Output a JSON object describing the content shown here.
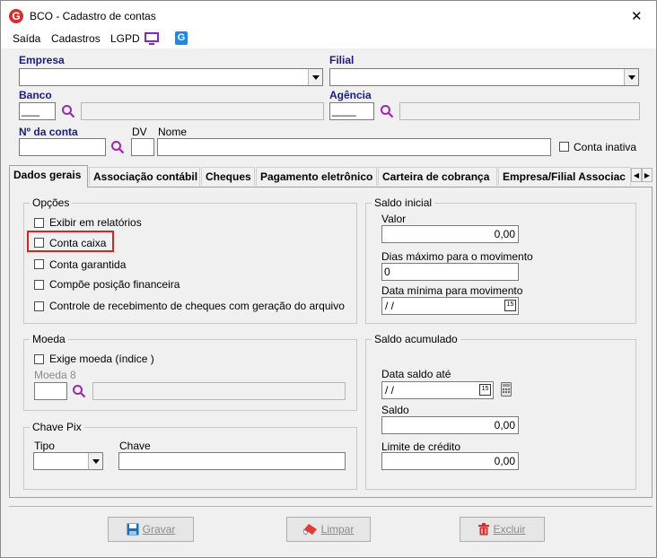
{
  "window": {
    "title": "BCO - Cadastro de contas",
    "close_glyph": "✕"
  },
  "menu": {
    "items": [
      "Saída",
      "Cadastros",
      "LGPD"
    ]
  },
  "header": {
    "empresa_label": "Empresa",
    "filial_label": "Filial",
    "banco_label": "Banco",
    "banco_value": "___",
    "agencia_label": "Agência",
    "agencia_value": "____",
    "conta_label": "Nº da conta",
    "dv_label": "DV",
    "nome_label": "Nome",
    "conta_inativa_label": "Conta inativa"
  },
  "tabs": [
    "Dados gerais",
    "Associação contábil",
    "Cheques",
    "Pagamento eletrônico",
    "Carteira de cobrança",
    "Empresa/Filial Associac"
  ],
  "tab_scroll": {
    "left": "◀",
    "right": "▶"
  },
  "opcoes": {
    "title": "Opções",
    "items": [
      "Exibir em relatórios",
      "Conta caixa",
      "Conta garantida",
      "Compõe posição financeira",
      "Controle de recebimento de cheques com geração do arquivo"
    ]
  },
  "moeda": {
    "title": "Moeda",
    "exige_label": "Exige moeda (índice )",
    "moeda_label": "Moeda 8"
  },
  "pix": {
    "title": "Chave Pix",
    "tipo_label": "Tipo",
    "chave_label": "Chave"
  },
  "saldo_inicial": {
    "title": "Saldo inicial",
    "valor_label": "Valor",
    "valor": "0,00",
    "dias_label": "Dias máximo para o movimento",
    "dias": "0",
    "data_label": "Data mínima para movimento",
    "data": " /  /",
    "cal_glyph": "15"
  },
  "saldo_acumulado": {
    "title": "Saldo acumulado",
    "data_label": "Data saldo até",
    "data": " /  /",
    "cal_glyph": "15",
    "saldo_label": "Saldo",
    "saldo": "0,00",
    "limite_label": "Limite de crédito",
    "limite": "0,00"
  },
  "buttons": {
    "gravar": "Gravar",
    "limpar": "Limpar",
    "excluir": "Excluir"
  },
  "colors": {
    "label_blue": "#1c1c7c",
    "highlight_red": "#e02020",
    "accent_purple": "#7b2cbf",
    "accent_blue": "#1e88e5"
  }
}
